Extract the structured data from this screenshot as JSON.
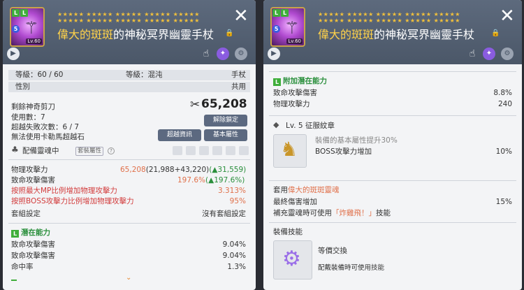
{
  "left": {
    "stars": "★★★★★ ★★★★★ ★★★★★ ★★★★★ ★★★★★\n★★★★★ ★★★★★ ★★★★★ ★★★★★ ★★★★★",
    "name_hl": "偉大的斑斑",
    "name_rest": "的神秘冥界幽靈手杖",
    "lv": "Lv.60",
    "row1_left": "等級：60 / 60",
    "row1_mid": "等級：混沌",
    "row1_right": "手杖",
    "row2_left": "性別",
    "row2_right": "共用",
    "scissors": "剩餘神奇剪刀",
    "price": "65,208",
    "used": "使用數：7",
    "fail": "超越失敗次數：6 / 7",
    "carry": "無法使用卡勒馬超越石",
    "btn_unlock": "解除鎖定",
    "btn_transcend": "超越資訊",
    "btn_attr": "基本屬性",
    "soul": "配備靈魂中",
    "set_attr": "套裝屬性",
    "stats": [
      {
        "label": "物理攻擊力",
        "val": "65,208",
        "paren": "(21,988+43,220)",
        "delta": "(▲31,559)"
      },
      {
        "label": "致命攻擊傷害",
        "val": "197.6%",
        "paren": "",
        "delta": "(▲197.6%)"
      }
    ],
    "red1": "按照最大MP比例增加物理攻擊力",
    "red1_v": "3.313%",
    "red2": "按照BOSS攻擊力比例增加物理攻擊力",
    "red2_v": "95%",
    "set_label": "套組設定",
    "set_value": "沒有套組設定",
    "potential_title": "潛在能力",
    "potential": [
      {
        "label": "致命攻擊傷害",
        "value": "9.04%"
      },
      {
        "label": "致命攻擊傷害",
        "value": "9.04%"
      },
      {
        "label": "命中率",
        "value": "1.3%"
      }
    ]
  },
  "right": {
    "stars": "★★★★★ ★★★★★ ★★★★★ ★★★★★ ★★★★★\n★★★★★ ★★★★★ ★★★★★ ★★★★★ ★★★★★",
    "name_hl": "偉大的斑斑",
    "name_rest": "的神秘冥界幽靈手杖",
    "lv": "Lv.60",
    "add_title": "附加潛在能力",
    "add": [
      {
        "label": "致命攻擊傷害",
        "value": "8.8%"
      },
      {
        "label": "物理攻擊力",
        "value": "240"
      }
    ],
    "emblem_title": "Lv. 5 征服紋章",
    "emblem_desc": "裝備的基本屬性提升30%",
    "emblem_stat": "BOSS攻擊力增加",
    "emblem_val": "10%",
    "soul_prefix": "套用",
    "soul_name": "偉大的斑斑靈魂",
    "soul_stat": "最終傷害增加",
    "soul_val": "15%",
    "soul_skill_pre": "補充靈魂時可使用",
    "soul_skill": "「炸雞飛！」",
    "soul_skill_post": "技能",
    "equip_skill_title": "裝備技能",
    "equip_skill_name": "等價交換",
    "equip_skill_desc": "配戴裝備時可使用技能"
  },
  "colors": {
    "accent_green": "#2a8f3c",
    "orange": "#e0704a",
    "red": "#d23a3a",
    "header": "#4b5768"
  },
  "icons": [
    "close-icon",
    "lock-icon",
    "play-icon",
    "hand-icon",
    "scissors-icon",
    "emblem-icon",
    "skill-gear-icon"
  ]
}
